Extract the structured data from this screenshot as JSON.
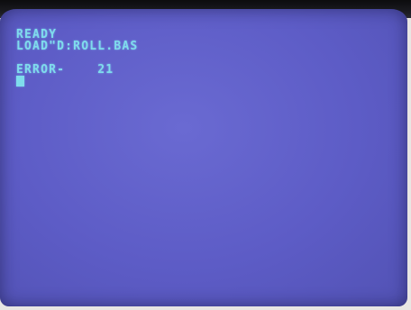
{
  "terminal": {
    "lines": [
      "READY",
      "LOAD\"D:ROLL.BAS",
      "",
      "ERROR-    21"
    ]
  },
  "colors": {
    "screen": "#5d5cc6",
    "text": "#7fdcec",
    "bezel": "#1c1c22"
  }
}
